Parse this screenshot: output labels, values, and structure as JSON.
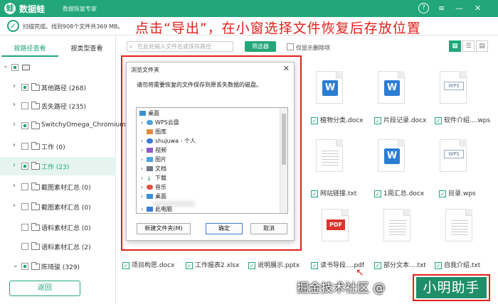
{
  "app": {
    "name": "数据蛙",
    "subtitle": "数据恢复专家",
    "logo_char": "蛙"
  },
  "window_controls": {
    "help": "?",
    "menu": "≡",
    "minimize": "—",
    "close": "✕"
  },
  "status": {
    "text": "扫描完成。找到908个文件共369 MB。"
  },
  "annotation": "点击“导出”，在小窗选择文件恢复后存放位置",
  "sidebar": {
    "tabs": [
      {
        "label": "按路径查看"
      },
      {
        "label": "按类型查看"
      }
    ],
    "items": [
      {
        "label": "其他路径 (268)"
      },
      {
        "label": "丢失路径 (235)"
      },
      {
        "label": "SwitchyOmega_Chromium"
      },
      {
        "label": "工作 (0)"
      },
      {
        "label": "工作 (23)"
      },
      {
        "label": "截图素材汇总 (0)"
      },
      {
        "label": "截图素材汇总 (0)"
      },
      {
        "label": "语料素材汇总 (0)"
      },
      {
        "label": "语料素材汇总 (2)"
      },
      {
        "label": "陈琦骏 (329)"
      }
    ],
    "back_label": "返回"
  },
  "toolbar": {
    "search_placeholder": "在此处输入文件名或保存路径",
    "filter_label": "筛选器",
    "only_deleted_label": "仅显示删除项"
  },
  "files": [
    {
      "name": "植物分类.docx",
      "kind": "word"
    },
    {
      "name": "片段记录.docx",
      "kind": "word"
    },
    {
      "name": "软件介绍....wps",
      "kind": "wps"
    },
    {
      "name": "网站链接.txt",
      "kind": "txt"
    },
    {
      "name": "1周汇总.docx",
      "kind": "word"
    },
    {
      "name": "目录.wps",
      "kind": "wps"
    },
    {
      "name": "读书导段....pdf",
      "kind": "pdf"
    },
    {
      "name": "部分文本....txt",
      "kind": "txt"
    },
    {
      "name": "自我介绍.txt",
      "kind": "txt"
    }
  ],
  "bottom_files": [
    {
      "name": "项目构思.docx"
    },
    {
      "name": "工作报表2.xlsx"
    },
    {
      "name": "说明展示.pptx"
    }
  ],
  "dialog": {
    "title": "浏览文件夹",
    "message": "请勿将需要恢复的文件保存到原丢失数据的磁盘。",
    "tree": [
      {
        "label": "桌面"
      },
      {
        "label": "WPS云盘"
      },
      {
        "label": "图库"
      },
      {
        "label": "shujuwa - 个人"
      },
      {
        "label": "视频"
      },
      {
        "label": "图片"
      },
      {
        "label": "文档"
      },
      {
        "label": "下载"
      },
      {
        "label": "音乐"
      },
      {
        "label": "桌面"
      },
      {
        "label": "此电脑"
      }
    ],
    "new_folder_label": "新建文件夹(M)",
    "ok_label": "确定",
    "cancel_label": "取消"
  },
  "watermark": "掘金技术社区 @",
  "assistant_label": "小明助手",
  "colors": {
    "accent": "#22a67a",
    "annotation": "#e0201b",
    "word": "#2b7cd3",
    "pdf": "#d9342b"
  }
}
